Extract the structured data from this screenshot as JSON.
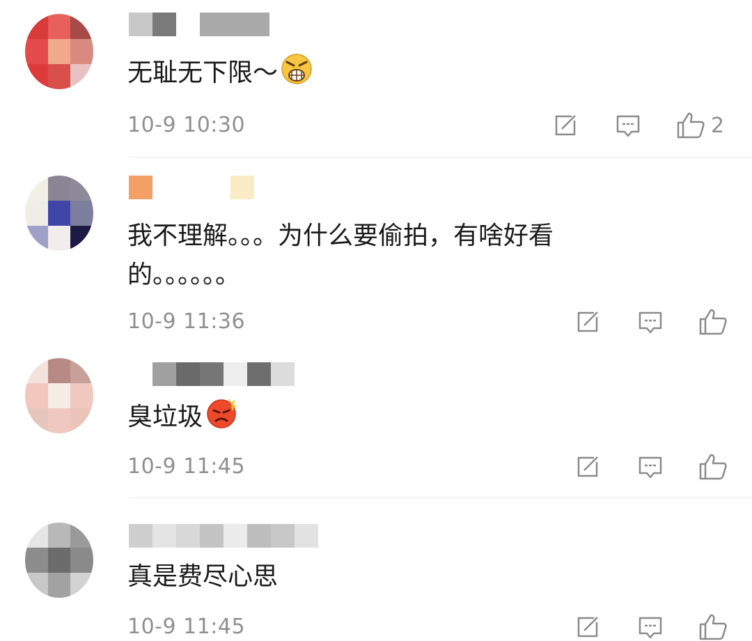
{
  "comments": [
    {
      "text": "无耻无下限～",
      "time": "10-9 10:30",
      "like_count": "2",
      "emoji": "angry-shouting-emoji"
    },
    {
      "text_line1": "我不理解。。。为什么要偷拍，有啥好看",
      "text_line2": "的。。。。。。",
      "time": "10-9 11:36"
    },
    {
      "text": "臭垃圾",
      "time": "10-9 11:45",
      "emoji": "angry-red-face-emoji"
    },
    {
      "text": "真是费尽心思",
      "time": "10-9 11:45"
    }
  ],
  "icons": {
    "share": "share-icon",
    "comment": "comment-icon",
    "like": "thumbs-up-icon"
  },
  "colors": {
    "text": "#1a1a1a",
    "meta": "#8f8f8f",
    "divider": "#ececec"
  }
}
